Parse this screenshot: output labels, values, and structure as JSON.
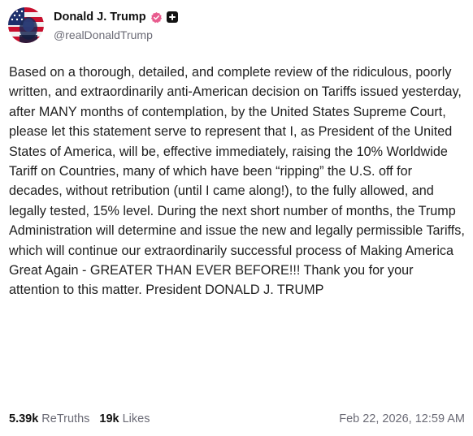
{
  "author": {
    "display_name": "Donald J. Trump",
    "handle": "@realDonaldTrump",
    "avatar_icon": "flag-portrait-avatar",
    "verified_icon": "verified-badge-icon",
    "verified_color": "#e85c8e",
    "plus_icon": "plus-badge-icon"
  },
  "post": {
    "text": "Based on a thorough, detailed, and complete review of the ridiculous, poorly written, and extraordinarily anti-American decision on Tariffs issued yesterday, after MANY months of contemplation, by the United States Supreme Court, please let this statement serve to represent that I, as President of the United States of America, will be, effective immediately, raising the 10% Worldwide Tariff on Countries, many of which have been “ripping” the U.S. off for decades, without retribution (until I came along!), to the fully allowed, and legally tested, 15% level. During the next short number of months, the Trump Administration will determine and issue the new and legally permissible Tariffs, which will continue our extraordinarily successful process of Making America Great Again - GREATER THAN EVER BEFORE!!! Thank you for your attention to this matter. President DONALD J. TRUMP"
  },
  "stats": {
    "retruths_count": "5.39k",
    "retruths_label": "ReTruths",
    "likes_count": "19k",
    "likes_label": "Likes"
  },
  "timestamp": "Feb 22, 2026, 12:59 AM"
}
